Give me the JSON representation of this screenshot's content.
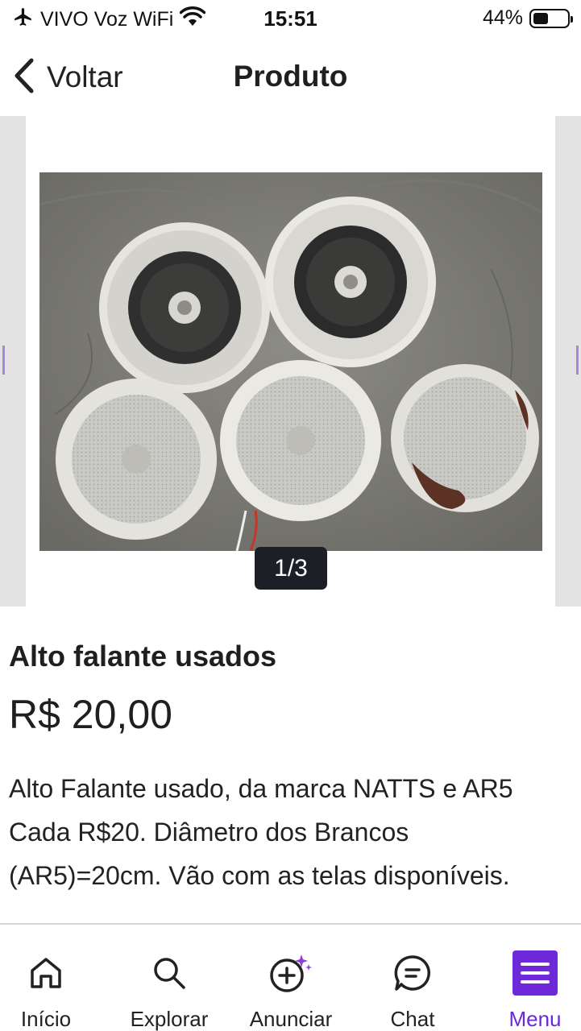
{
  "status_bar": {
    "carrier": "VIVO Voz WiFi",
    "time": "15:51",
    "battery_text": "44%",
    "battery_level": 0.44
  },
  "header": {
    "back_label": "Voltar",
    "title": "Produto"
  },
  "carousel": {
    "counter": "1/3",
    "image_alt": "Alto falantes brancos usados sobre piso de concreto"
  },
  "product": {
    "title": "Alto falante usados",
    "price": "R$ 20,00",
    "description_lines": [
      "Alto Falante usado, da marca NATTS e AR5",
      "Cada R$20. Diâmetro dos Brancos",
      "(AR5)=20cm. Vão com as telas disponíveis."
    ]
  },
  "bottom_nav": {
    "items": [
      {
        "label": "Início",
        "icon": "home-icon"
      },
      {
        "label": "Explorar",
        "icon": "search-icon"
      },
      {
        "label": "Anunciar",
        "icon": "add-sparkle-icon"
      },
      {
        "label": "Chat",
        "icon": "chat-icon"
      },
      {
        "label": "Menu",
        "icon": "menu-icon",
        "active": true
      }
    ]
  },
  "colors": {
    "accent": "#6d28d9",
    "text": "#1f1f1f",
    "counter_bg": "#1c1f26"
  }
}
